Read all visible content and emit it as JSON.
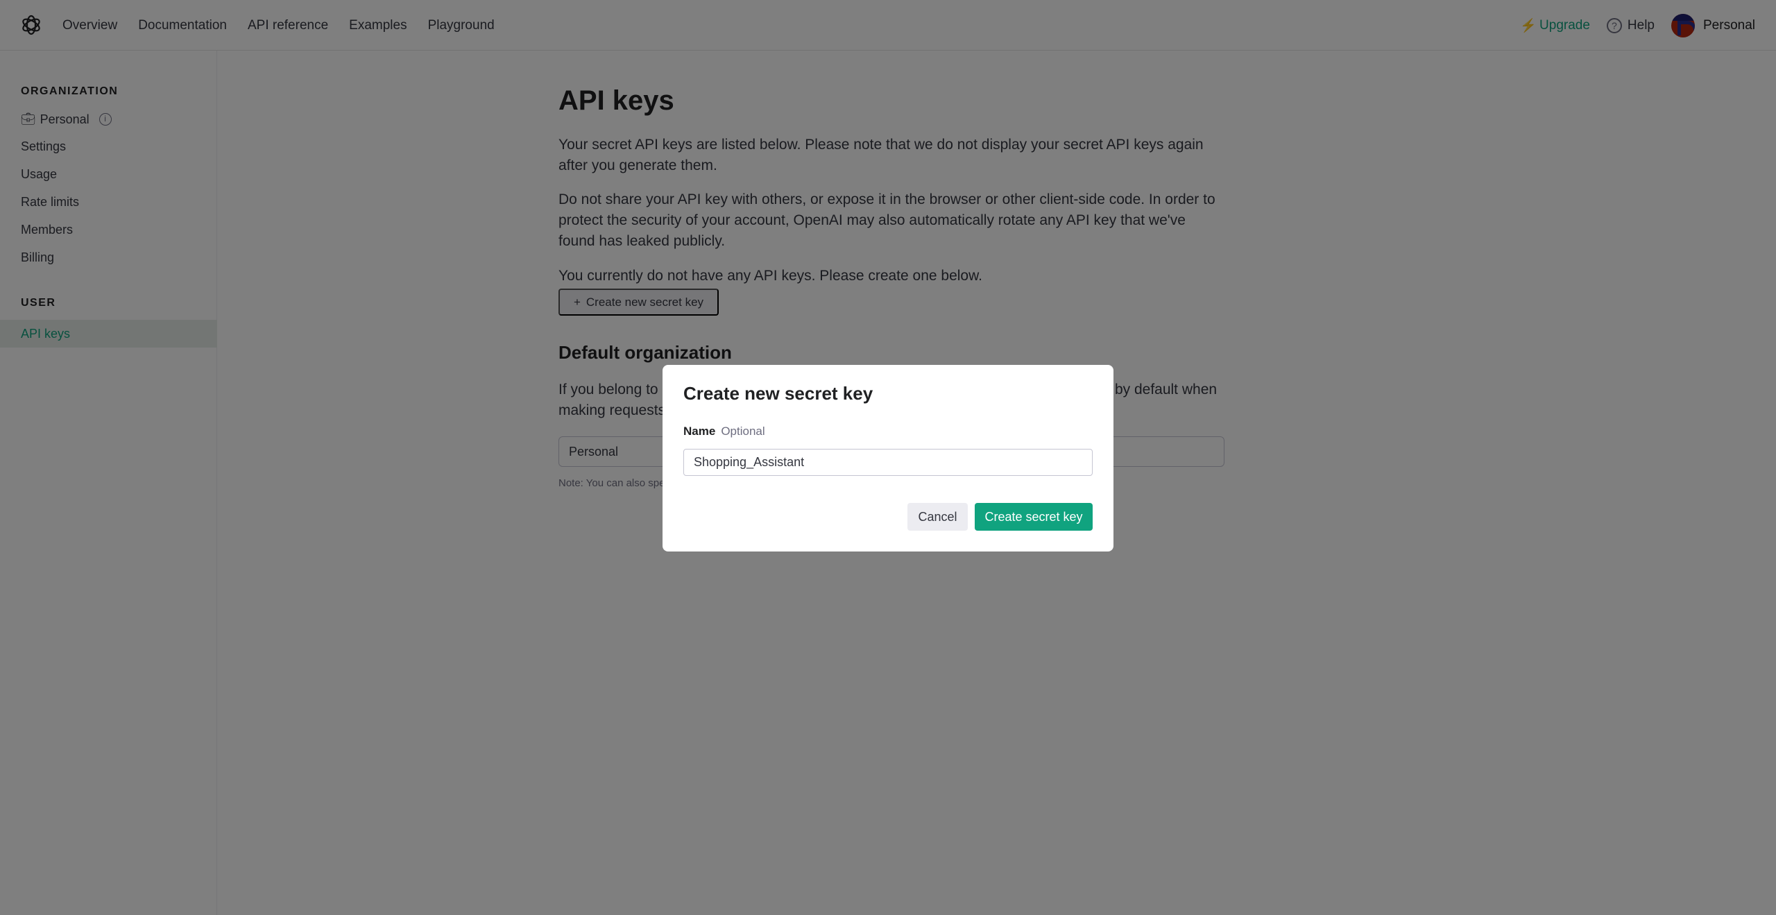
{
  "header": {
    "nav": [
      "Overview",
      "Documentation",
      "API reference",
      "Examples",
      "Playground"
    ],
    "upgrade": "Upgrade",
    "help": "Help",
    "account": "Personal"
  },
  "sidebar": {
    "org_heading": "ORGANIZATION",
    "org_name": "Personal",
    "org_items": [
      "Settings",
      "Usage",
      "Rate limits",
      "Members",
      "Billing"
    ],
    "user_heading": "USER",
    "user_items": [
      "API keys"
    ]
  },
  "main": {
    "title": "API keys",
    "p1": "Your secret API keys are listed below. Please note that we do not display your secret API keys again after you generate them.",
    "p2": "Do not share your API key with others, or expose it in the browser or other client-side code. In order to protect the security of your account, OpenAI may also automatically rotate any API key that we've found has leaked publicly.",
    "p3": "You currently do not have any API keys. Please create one below.",
    "create_button": "Create new secret key",
    "default_org_title": "Default organization",
    "default_org_text": "If you belong to multiple organizations, this setting controls which organization is used by default when making requests with the API keys above.",
    "default_org_value": "Personal",
    "note": "Note: You can also specify which organization to use for each API request. See Authentication to learn more."
  },
  "modal": {
    "title": "Create new secret key",
    "name_label": "Name",
    "name_hint": "Optional",
    "name_value": "Shopping_Assistant",
    "cancel": "Cancel",
    "submit": "Create secret key"
  },
  "colors": {
    "accent": "#10a37f",
    "overlay": "rgba(0,0,0,0.5)"
  }
}
